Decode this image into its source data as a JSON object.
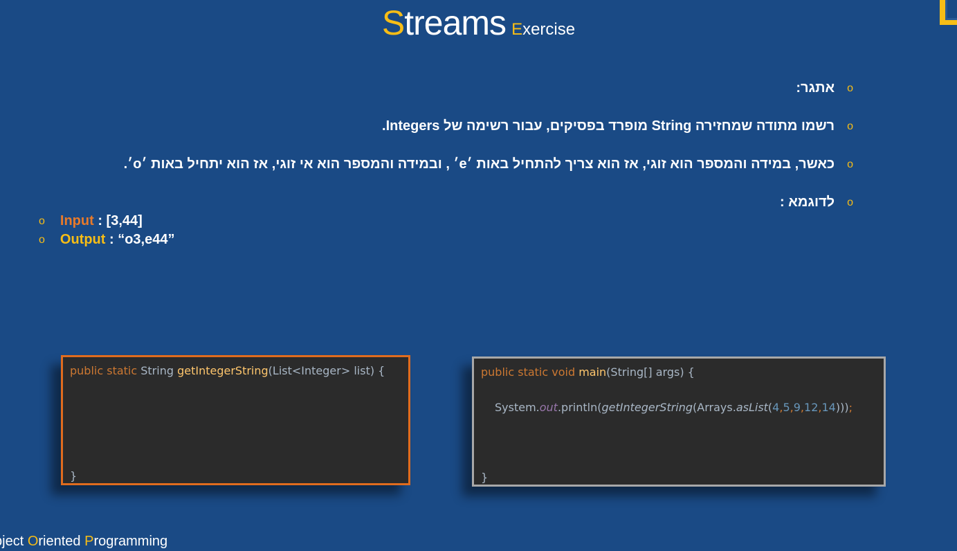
{
  "title": {
    "first_letter": "S",
    "rest": "treams",
    "sub_first": "E",
    "sub_rest": "xercise"
  },
  "bullets": [
    "אתגר:",
    "רשמו מתודה שמחזירה String מופרד בפסיקים, עבור רשימה של Integers.",
    "כאשר, במידה והמספר הוא זוגי, אז הוא צריך להתחיל באות ׳e׳ , ובמידה והמספר הוא אי זוגי, אז הוא יתחיל באות ׳o׳.",
    "לדוגמא :"
  ],
  "bullet_symbol": "o",
  "example": {
    "input_label": "Input",
    "input_value": " : [3,44]",
    "output_label": "Output",
    "output_value": " : “o3,e44”"
  },
  "code1": {
    "line1": [
      {
        "t": "public static ",
        "c": "kw"
      },
      {
        "t": "String ",
        "c": ""
      },
      {
        "t": "getIntegerString",
        "c": "fn"
      },
      {
        "t": "(List<Integer> list) {",
        "c": ""
      }
    ],
    "close": "}"
  },
  "code2": {
    "line1": [
      {
        "t": "public static void ",
        "c": "kw"
      },
      {
        "t": "main",
        "c": "fn"
      },
      {
        "t": "(String[] args) {",
        "c": ""
      }
    ],
    "line2": [
      {
        "t": "System.",
        "c": ""
      },
      {
        "t": "out",
        "c": "pu"
      },
      {
        "t": ".println(",
        "c": ""
      },
      {
        "t": "getIntegerString",
        "c": "it"
      },
      {
        "t": "(Arrays.",
        "c": ""
      },
      {
        "t": "asList",
        "c": "it"
      },
      {
        "t": "(",
        "c": ""
      },
      {
        "t": "4",
        "c": "nm"
      },
      {
        "t": ",",
        "c": "kw"
      },
      {
        "t": "5",
        "c": "nm"
      },
      {
        "t": ",",
        "c": "kw"
      },
      {
        "t": "9",
        "c": "nm"
      },
      {
        "t": ",",
        "c": "kw"
      },
      {
        "t": "12",
        "c": "nm"
      },
      {
        "t": ",",
        "c": "kw"
      },
      {
        "t": "14",
        "c": "nm"
      },
      {
        "t": ")))",
        "c": ""
      },
      {
        "t": ";",
        "c": "kw"
      }
    ],
    "close": "}"
  },
  "footer": {
    "parts": [
      {
        "t": "bject ",
        "c": ""
      },
      {
        "t": "O",
        "c": "y"
      },
      {
        "t": "riented ",
        "c": ""
      },
      {
        "t": "P",
        "c": "y"
      },
      {
        "t": "rogramming",
        "c": ""
      }
    ]
  }
}
